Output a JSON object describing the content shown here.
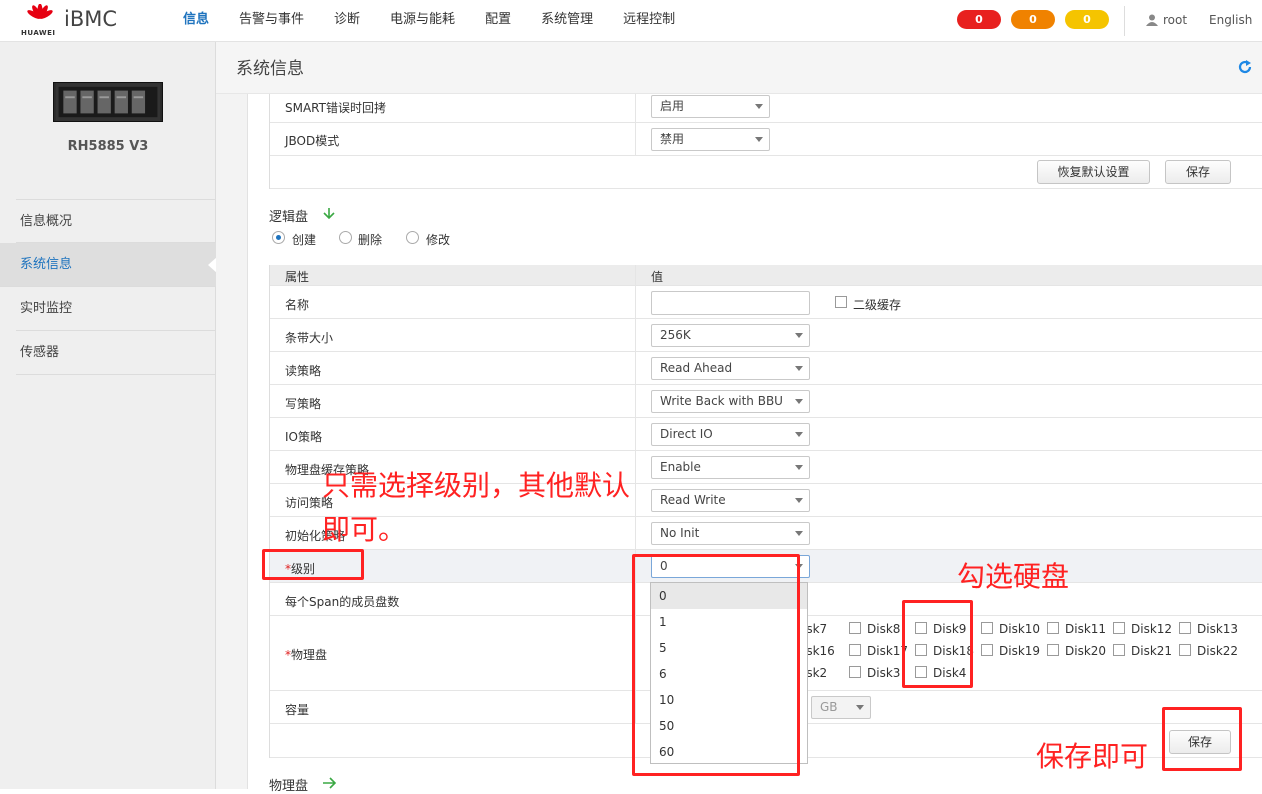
{
  "header": {
    "brand": "iBMC",
    "logo_text": "HUAWEI",
    "nav": [
      "信息",
      "告警与事件",
      "诊断",
      "电源与能耗",
      "配置",
      "系统管理",
      "远程控制"
    ],
    "alerts": [
      {
        "count": "0",
        "color": "#e8201e"
      },
      {
        "count": "0",
        "color": "#f08200"
      },
      {
        "count": "0",
        "color": "#f5c400"
      }
    ],
    "user": "root",
    "language": "English"
  },
  "sidebar": {
    "device_name": "RH5885 V3",
    "items": [
      "信息概况",
      "系统信息",
      "实时监控",
      "传感器"
    ]
  },
  "page": {
    "title": "系统信息"
  },
  "top_table": {
    "rows": [
      {
        "label": "SMART错误时回拷",
        "value": "启用"
      },
      {
        "label": "JBOD模式",
        "value": "禁用"
      }
    ],
    "restore_button": "恢复默认设置",
    "save_button": "保存"
  },
  "logical_disk": {
    "section_title": "逻辑盘",
    "radios": [
      "创建",
      "删除",
      "修改"
    ],
    "header": {
      "attr": "属性",
      "value": "值"
    },
    "name_label": "名称",
    "name_value": "",
    "cache_checkbox": "二级缓存",
    "rows": [
      {
        "label": "条带大小",
        "value": "256K"
      },
      {
        "label": "读策略",
        "value": "Read Ahead"
      },
      {
        "label": "写策略",
        "value": "Write Back with BBU"
      },
      {
        "label": "IO策略",
        "value": "Direct IO"
      },
      {
        "label": "物理盘缓存策略",
        "value": "Enable"
      },
      {
        "label": "访问策略",
        "value": "Read Write"
      },
      {
        "label": "初始化策略",
        "value": "No Init"
      }
    ],
    "level_label": "级别",
    "required_mark": "*",
    "level_value": "0",
    "level_options": [
      "0",
      "1",
      "5",
      "6",
      "10",
      "50",
      "60"
    ],
    "span_label": "每个Span的成员盘数",
    "pd_label": "物理盘",
    "disks_row1": [
      "isk7",
      "Disk8",
      "Disk9",
      "Disk10",
      "Disk11",
      "Disk12",
      "Disk13"
    ],
    "disks_row2": [
      "isk16",
      "Disk17",
      "Disk18",
      "Disk19",
      "Disk20",
      "Disk21",
      "Disk22"
    ],
    "disks_row3": [
      "isk2",
      "Disk3",
      "Disk4"
    ],
    "capacity_label": "容量",
    "capacity_unit": "GB",
    "save_button": "保存"
  },
  "physical_disk": {
    "section_title": "物理盘"
  },
  "annotations": {
    "level_note_line1": "只需选择级别，其他默认",
    "level_note_line2": "即可。",
    "disk_note": "勾选硬盘",
    "save_note": "保存即可"
  }
}
